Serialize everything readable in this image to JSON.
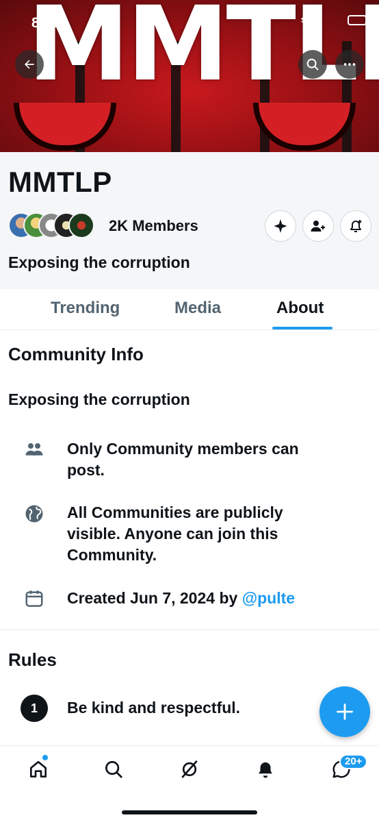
{
  "status_bar": {
    "time": "8:22",
    "carrier": "SOS"
  },
  "banner": {
    "text": "MMTLP"
  },
  "community": {
    "name": "MMTLP",
    "members": "2K Members",
    "tagline": "Exposing the corruption"
  },
  "tabs": [
    {
      "label": "Trending"
    },
    {
      "label": "Media"
    },
    {
      "label": "About",
      "active": true
    }
  ],
  "about": {
    "info_title": "Community Info",
    "description": "Exposing the corruption",
    "rows": [
      {
        "icon": "people-icon",
        "text": "Only Community members can post."
      },
      {
        "icon": "globe-icon",
        "text": "All Communities are publicly visible. Anyone can join this Community."
      },
      {
        "icon": "calendar-icon",
        "text_prefix": "Created Jun 7, 2024 by ",
        "mention": "@pulte"
      }
    ],
    "rules_title": "Rules",
    "rules": [
      {
        "number": "1",
        "text": "Be kind and respectful."
      }
    ]
  },
  "bottom_nav": {
    "items": [
      "home-icon",
      "search-icon",
      "grok-icon",
      "bell-icon",
      "messages-icon"
    ],
    "messages_badge": "20+"
  },
  "colors": {
    "accent": "#1d9bf0",
    "text": "#0f1419",
    "muted": "#536471",
    "header_bg": "#f5f6f7",
    "banner_red": "#c8191d"
  }
}
